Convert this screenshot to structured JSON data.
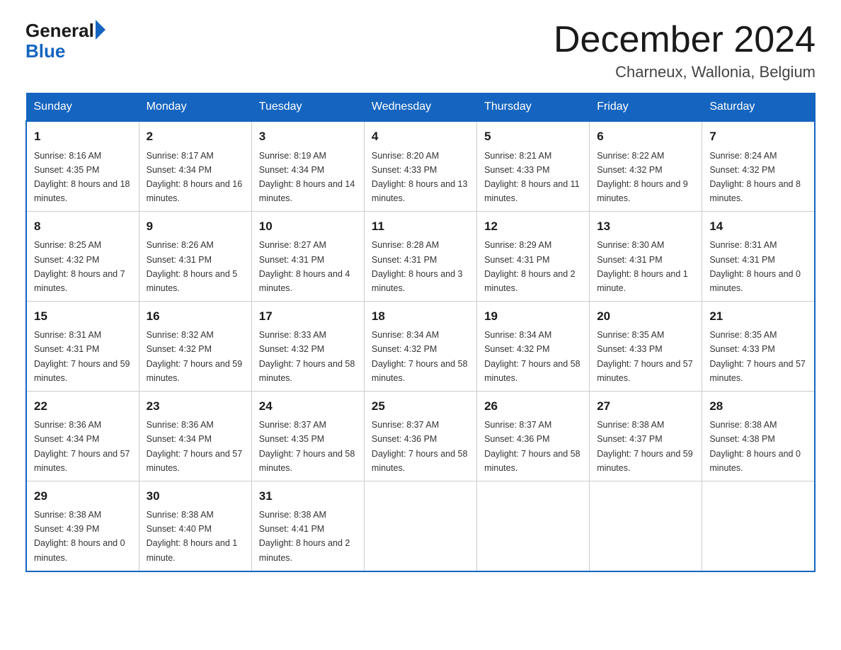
{
  "logo": {
    "general": "General",
    "blue": "Blue"
  },
  "title": "December 2024",
  "subtitle": "Charneux, Wallonia, Belgium",
  "weekdays": [
    "Sunday",
    "Monday",
    "Tuesday",
    "Wednesday",
    "Thursday",
    "Friday",
    "Saturday"
  ],
  "weeks": [
    [
      {
        "day": "1",
        "sunrise": "8:16 AM",
        "sunset": "4:35 PM",
        "daylight": "8 hours and 18 minutes."
      },
      {
        "day": "2",
        "sunrise": "8:17 AM",
        "sunset": "4:34 PM",
        "daylight": "8 hours and 16 minutes."
      },
      {
        "day": "3",
        "sunrise": "8:19 AM",
        "sunset": "4:34 PM",
        "daylight": "8 hours and 14 minutes."
      },
      {
        "day": "4",
        "sunrise": "8:20 AM",
        "sunset": "4:33 PM",
        "daylight": "8 hours and 13 minutes."
      },
      {
        "day": "5",
        "sunrise": "8:21 AM",
        "sunset": "4:33 PM",
        "daylight": "8 hours and 11 minutes."
      },
      {
        "day": "6",
        "sunrise": "8:22 AM",
        "sunset": "4:32 PM",
        "daylight": "8 hours and 9 minutes."
      },
      {
        "day": "7",
        "sunrise": "8:24 AM",
        "sunset": "4:32 PM",
        "daylight": "8 hours and 8 minutes."
      }
    ],
    [
      {
        "day": "8",
        "sunrise": "8:25 AM",
        "sunset": "4:32 PM",
        "daylight": "8 hours and 7 minutes."
      },
      {
        "day": "9",
        "sunrise": "8:26 AM",
        "sunset": "4:31 PM",
        "daylight": "8 hours and 5 minutes."
      },
      {
        "day": "10",
        "sunrise": "8:27 AM",
        "sunset": "4:31 PM",
        "daylight": "8 hours and 4 minutes."
      },
      {
        "day": "11",
        "sunrise": "8:28 AM",
        "sunset": "4:31 PM",
        "daylight": "8 hours and 3 minutes."
      },
      {
        "day": "12",
        "sunrise": "8:29 AM",
        "sunset": "4:31 PM",
        "daylight": "8 hours and 2 minutes."
      },
      {
        "day": "13",
        "sunrise": "8:30 AM",
        "sunset": "4:31 PM",
        "daylight": "8 hours and 1 minute."
      },
      {
        "day": "14",
        "sunrise": "8:31 AM",
        "sunset": "4:31 PM",
        "daylight": "8 hours and 0 minutes."
      }
    ],
    [
      {
        "day": "15",
        "sunrise": "8:31 AM",
        "sunset": "4:31 PM",
        "daylight": "7 hours and 59 minutes."
      },
      {
        "day": "16",
        "sunrise": "8:32 AM",
        "sunset": "4:32 PM",
        "daylight": "7 hours and 59 minutes."
      },
      {
        "day": "17",
        "sunrise": "8:33 AM",
        "sunset": "4:32 PM",
        "daylight": "7 hours and 58 minutes."
      },
      {
        "day": "18",
        "sunrise": "8:34 AM",
        "sunset": "4:32 PM",
        "daylight": "7 hours and 58 minutes."
      },
      {
        "day": "19",
        "sunrise": "8:34 AM",
        "sunset": "4:32 PM",
        "daylight": "7 hours and 58 minutes."
      },
      {
        "day": "20",
        "sunrise": "8:35 AM",
        "sunset": "4:33 PM",
        "daylight": "7 hours and 57 minutes."
      },
      {
        "day": "21",
        "sunrise": "8:35 AM",
        "sunset": "4:33 PM",
        "daylight": "7 hours and 57 minutes."
      }
    ],
    [
      {
        "day": "22",
        "sunrise": "8:36 AM",
        "sunset": "4:34 PM",
        "daylight": "7 hours and 57 minutes."
      },
      {
        "day": "23",
        "sunrise": "8:36 AM",
        "sunset": "4:34 PM",
        "daylight": "7 hours and 57 minutes."
      },
      {
        "day": "24",
        "sunrise": "8:37 AM",
        "sunset": "4:35 PM",
        "daylight": "7 hours and 58 minutes."
      },
      {
        "day": "25",
        "sunrise": "8:37 AM",
        "sunset": "4:36 PM",
        "daylight": "7 hours and 58 minutes."
      },
      {
        "day": "26",
        "sunrise": "8:37 AM",
        "sunset": "4:36 PM",
        "daylight": "7 hours and 58 minutes."
      },
      {
        "day": "27",
        "sunrise": "8:38 AM",
        "sunset": "4:37 PM",
        "daylight": "7 hours and 59 minutes."
      },
      {
        "day": "28",
        "sunrise": "8:38 AM",
        "sunset": "4:38 PM",
        "daylight": "8 hours and 0 minutes."
      }
    ],
    [
      {
        "day": "29",
        "sunrise": "8:38 AM",
        "sunset": "4:39 PM",
        "daylight": "8 hours and 0 minutes."
      },
      {
        "day": "30",
        "sunrise": "8:38 AM",
        "sunset": "4:40 PM",
        "daylight": "8 hours and 1 minute."
      },
      {
        "day": "31",
        "sunrise": "8:38 AM",
        "sunset": "4:41 PM",
        "daylight": "8 hours and 2 minutes."
      },
      null,
      null,
      null,
      null
    ]
  ]
}
